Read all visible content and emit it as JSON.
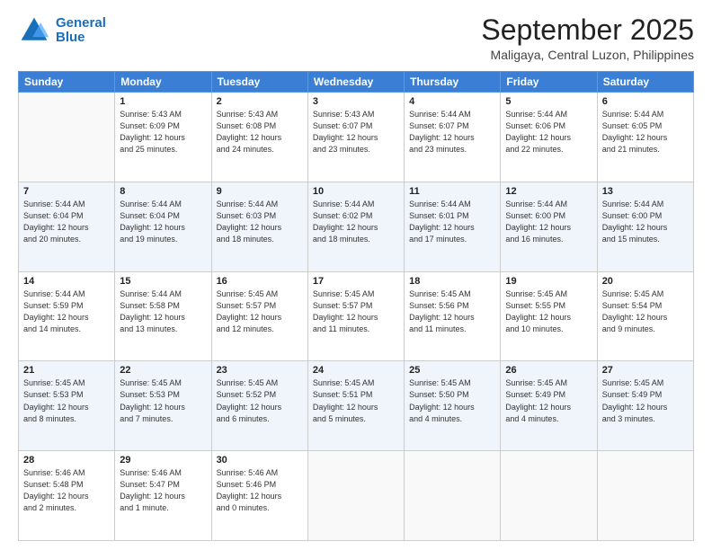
{
  "logo": {
    "line1": "General",
    "line2": "Blue"
  },
  "header": {
    "month": "September 2025",
    "location": "Maligaya, Central Luzon, Philippines"
  },
  "weekdays": [
    "Sunday",
    "Monday",
    "Tuesday",
    "Wednesday",
    "Thursday",
    "Friday",
    "Saturday"
  ],
  "weeks": [
    [
      {
        "day": "",
        "info": ""
      },
      {
        "day": "1",
        "info": "Sunrise: 5:43 AM\nSunset: 6:09 PM\nDaylight: 12 hours\nand 25 minutes."
      },
      {
        "day": "2",
        "info": "Sunrise: 5:43 AM\nSunset: 6:08 PM\nDaylight: 12 hours\nand 24 minutes."
      },
      {
        "day": "3",
        "info": "Sunrise: 5:43 AM\nSunset: 6:07 PM\nDaylight: 12 hours\nand 23 minutes."
      },
      {
        "day": "4",
        "info": "Sunrise: 5:44 AM\nSunset: 6:07 PM\nDaylight: 12 hours\nand 23 minutes."
      },
      {
        "day": "5",
        "info": "Sunrise: 5:44 AM\nSunset: 6:06 PM\nDaylight: 12 hours\nand 22 minutes."
      },
      {
        "day": "6",
        "info": "Sunrise: 5:44 AM\nSunset: 6:05 PM\nDaylight: 12 hours\nand 21 minutes."
      }
    ],
    [
      {
        "day": "7",
        "info": "Sunrise: 5:44 AM\nSunset: 6:04 PM\nDaylight: 12 hours\nand 20 minutes."
      },
      {
        "day": "8",
        "info": "Sunrise: 5:44 AM\nSunset: 6:04 PM\nDaylight: 12 hours\nand 19 minutes."
      },
      {
        "day": "9",
        "info": "Sunrise: 5:44 AM\nSunset: 6:03 PM\nDaylight: 12 hours\nand 18 minutes."
      },
      {
        "day": "10",
        "info": "Sunrise: 5:44 AM\nSunset: 6:02 PM\nDaylight: 12 hours\nand 18 minutes."
      },
      {
        "day": "11",
        "info": "Sunrise: 5:44 AM\nSunset: 6:01 PM\nDaylight: 12 hours\nand 17 minutes."
      },
      {
        "day": "12",
        "info": "Sunrise: 5:44 AM\nSunset: 6:00 PM\nDaylight: 12 hours\nand 16 minutes."
      },
      {
        "day": "13",
        "info": "Sunrise: 5:44 AM\nSunset: 6:00 PM\nDaylight: 12 hours\nand 15 minutes."
      }
    ],
    [
      {
        "day": "14",
        "info": "Sunrise: 5:44 AM\nSunset: 5:59 PM\nDaylight: 12 hours\nand 14 minutes."
      },
      {
        "day": "15",
        "info": "Sunrise: 5:44 AM\nSunset: 5:58 PM\nDaylight: 12 hours\nand 13 minutes."
      },
      {
        "day": "16",
        "info": "Sunrise: 5:45 AM\nSunset: 5:57 PM\nDaylight: 12 hours\nand 12 minutes."
      },
      {
        "day": "17",
        "info": "Sunrise: 5:45 AM\nSunset: 5:57 PM\nDaylight: 12 hours\nand 11 minutes."
      },
      {
        "day": "18",
        "info": "Sunrise: 5:45 AM\nSunset: 5:56 PM\nDaylight: 12 hours\nand 11 minutes."
      },
      {
        "day": "19",
        "info": "Sunrise: 5:45 AM\nSunset: 5:55 PM\nDaylight: 12 hours\nand 10 minutes."
      },
      {
        "day": "20",
        "info": "Sunrise: 5:45 AM\nSunset: 5:54 PM\nDaylight: 12 hours\nand 9 minutes."
      }
    ],
    [
      {
        "day": "21",
        "info": "Sunrise: 5:45 AM\nSunset: 5:53 PM\nDaylight: 12 hours\nand 8 minutes."
      },
      {
        "day": "22",
        "info": "Sunrise: 5:45 AM\nSunset: 5:53 PM\nDaylight: 12 hours\nand 7 minutes."
      },
      {
        "day": "23",
        "info": "Sunrise: 5:45 AM\nSunset: 5:52 PM\nDaylight: 12 hours\nand 6 minutes."
      },
      {
        "day": "24",
        "info": "Sunrise: 5:45 AM\nSunset: 5:51 PM\nDaylight: 12 hours\nand 5 minutes."
      },
      {
        "day": "25",
        "info": "Sunrise: 5:45 AM\nSunset: 5:50 PM\nDaylight: 12 hours\nand 4 minutes."
      },
      {
        "day": "26",
        "info": "Sunrise: 5:45 AM\nSunset: 5:49 PM\nDaylight: 12 hours\nand 4 minutes."
      },
      {
        "day": "27",
        "info": "Sunrise: 5:45 AM\nSunset: 5:49 PM\nDaylight: 12 hours\nand 3 minutes."
      }
    ],
    [
      {
        "day": "28",
        "info": "Sunrise: 5:46 AM\nSunset: 5:48 PM\nDaylight: 12 hours\nand 2 minutes."
      },
      {
        "day": "29",
        "info": "Sunrise: 5:46 AM\nSunset: 5:47 PM\nDaylight: 12 hours\nand 1 minute."
      },
      {
        "day": "30",
        "info": "Sunrise: 5:46 AM\nSunset: 5:46 PM\nDaylight: 12 hours\nand 0 minutes."
      },
      {
        "day": "",
        "info": ""
      },
      {
        "day": "",
        "info": ""
      },
      {
        "day": "",
        "info": ""
      },
      {
        "day": "",
        "info": ""
      }
    ]
  ]
}
